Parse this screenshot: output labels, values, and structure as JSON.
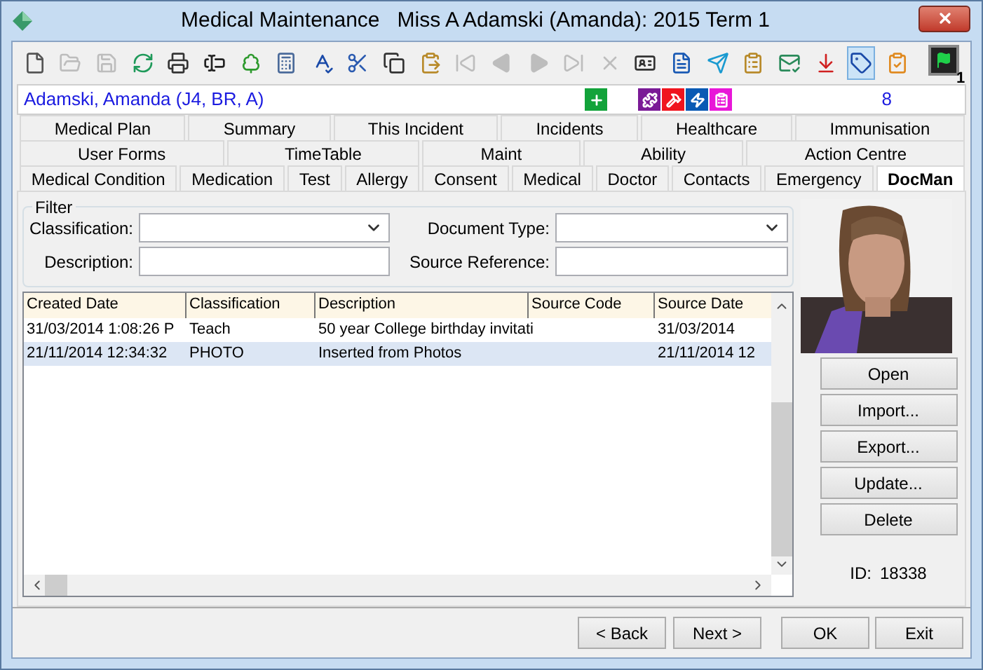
{
  "window": {
    "title": "Medical Maintenance   Miss A Adamski (Amanda): 2015 Term 1"
  },
  "toolbar": [
    {
      "disabled": false,
      "selected": false
    },
    {
      "disabled": true,
      "selected": false
    },
    {
      "disabled": true,
      "selected": false
    },
    {
      "disabled": false,
      "selected": false
    },
    {
      "disabled": false,
      "selected": false
    },
    {
      "disabled": false,
      "selected": false
    },
    {
      "disabled": false,
      "selected": false
    },
    {
      "disabled": false,
      "selected": false
    },
    {
      "disabled": false,
      "selected": false
    },
    {
      "disabled": false,
      "selected": false
    },
    {
      "disabled": false,
      "selected": false
    },
    {
      "disabled": false,
      "selected": false
    },
    {
      "disabled": true,
      "selected": false
    },
    {
      "disabled": true,
      "selected": false
    },
    {
      "disabled": true,
      "selected": false
    },
    {
      "disabled": true,
      "selected": false
    },
    {
      "disabled": true,
      "selected": false
    },
    {
      "disabled": false,
      "selected": false
    },
    {
      "disabled": false,
      "selected": false
    },
    {
      "disabled": false,
      "selected": false
    },
    {
      "disabled": false,
      "selected": false
    },
    {
      "disabled": false,
      "selected": false
    },
    {
      "disabled": false,
      "selected": false
    },
    {
      "disabled": false,
      "selected": true
    },
    {
      "disabled": false,
      "selected": false
    }
  ],
  "flag_button": {
    "badge": "1"
  },
  "student_bar": {
    "name": "Adamski, Amanda (J4, BR, A)",
    "count": "8",
    "alerts": [
      {
        "color": "#12a33a"
      },
      {
        "color": "#7a1a96"
      },
      {
        "color": "#f0141e"
      },
      {
        "color": "#0a5ab4"
      },
      {
        "color": "#e817d8"
      }
    ]
  },
  "tab_rows": [
    [
      {
        "label": "Medical Plan",
        "selected": false
      },
      {
        "label": "Summary",
        "selected": false
      },
      {
        "label": "This Incident",
        "selected": false
      },
      {
        "label": "Incidents",
        "selected": false
      },
      {
        "label": "Healthcare",
        "selected": false
      },
      {
        "label": "Immunisation",
        "selected": false
      }
    ],
    [
      {
        "label": "User Forms",
        "selected": false
      },
      {
        "label": "TimeTable",
        "selected": false
      },
      {
        "label": "Maint",
        "selected": false
      },
      {
        "label": "Ability",
        "selected": false
      },
      {
        "label": "Action Centre",
        "selected": false
      }
    ],
    [
      {
        "label": "Medical Condition",
        "selected": false
      },
      {
        "label": "Medication",
        "selected": false
      },
      {
        "label": "Test",
        "selected": false
      },
      {
        "label": "Allergy",
        "selected": false
      },
      {
        "label": "Consent",
        "selected": false
      },
      {
        "label": "Medical",
        "selected": false
      },
      {
        "label": "Doctor",
        "selected": false
      },
      {
        "label": "Contacts",
        "selected": false
      },
      {
        "label": "Emergency",
        "selected": false
      },
      {
        "label": "DocMan",
        "selected": true
      }
    ]
  ],
  "filter": {
    "title": "Filter",
    "classification_label": "Classification:",
    "document_type_label": "Document Type:",
    "description_label": "Description:",
    "source_reference_label": "Source Reference:"
  },
  "table": {
    "columns": [
      "Created Date",
      "Classification",
      "Description",
      "Source Code",
      "Source Date"
    ],
    "rows": [
      {
        "cells": [
          "31/03/2014 1:08:26 P",
          "Teach",
          "50 year College birthday invitati",
          "",
          "31/03/2014"
        ],
        "selected": false
      },
      {
        "cells": [
          "21/11/2014 12:34:32",
          "PHOTO",
          "Inserted from Photos",
          "",
          "21/11/2014 12"
        ],
        "selected": true
      }
    ]
  },
  "side_buttons": [
    "Open",
    "Import...",
    "Export...",
    "Update...",
    "Delete"
  ],
  "id_label": "ID:",
  "id_value": "18338",
  "footer_buttons": [
    "< Back",
    "Next >",
    "OK",
    "Exit"
  ]
}
